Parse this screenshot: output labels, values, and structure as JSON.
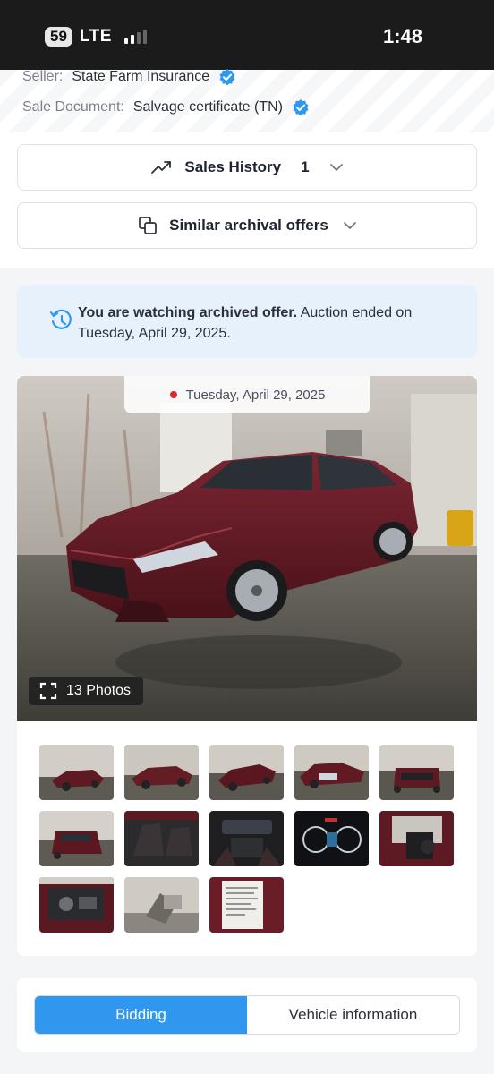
{
  "status_bar": {
    "battery": "59",
    "network": "LTE",
    "time": "1:48"
  },
  "seller": {
    "label": "Seller:",
    "value": "State Farm Insurance"
  },
  "sale_document": {
    "label": "Sale Document:",
    "value": "Salvage certificate (TN)"
  },
  "sales_history": {
    "label": "Sales History",
    "count": "1"
  },
  "similar_offers": {
    "label": "Similar archival offers"
  },
  "notice": {
    "bold": "You are watching archived offer.",
    "rest": " Auction ended on Tuesday, April 29, 2025."
  },
  "gallery": {
    "date": "Tuesday, April 29, 2025",
    "photos_label": "13 Photos"
  },
  "tabs": {
    "bidding": "Bidding",
    "vehicle_info": "Vehicle information"
  },
  "colors": {
    "accent": "#2f98ee",
    "car": "#5e1a22",
    "notice_bg": "#e7f1fb"
  }
}
